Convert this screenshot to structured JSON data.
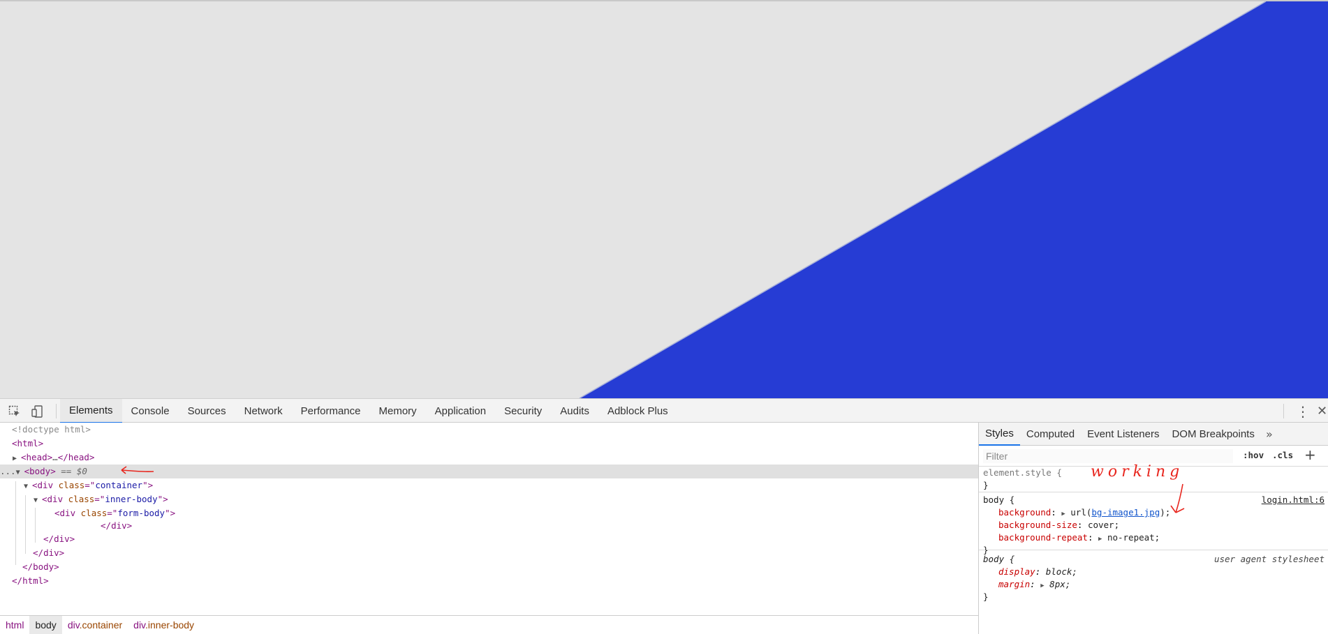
{
  "viewport": {
    "bg_color": "#e4e4e4",
    "shape_color": "#263cd4"
  },
  "toolbar": {
    "inspect_icon": "inspect-element-icon",
    "device_icon": "device-toolbar-icon",
    "tabs": [
      {
        "label": "Elements",
        "active": true
      },
      {
        "label": "Console"
      },
      {
        "label": "Sources"
      },
      {
        "label": "Network"
      },
      {
        "label": "Performance"
      },
      {
        "label": "Memory"
      },
      {
        "label": "Application"
      },
      {
        "label": "Security"
      },
      {
        "label": "Audits"
      },
      {
        "label": "Adblock Plus"
      }
    ],
    "menu_icon": "kebab-menu-icon",
    "close_icon": "close-icon"
  },
  "dom": {
    "doctype": "<!doctype html>",
    "html_open": "html",
    "head": "head",
    "head_ellipsis": "…",
    "body_tag": "body",
    "body_suffix": "== $0",
    "ellipsis": "...",
    "div_tag": "div",
    "class_attr": "class",
    "container_class": "container",
    "inner_body_class": "inner-body",
    "form_body_class": "form-body"
  },
  "breadcrumb": {
    "items": [
      "html",
      "body",
      "div",
      "div"
    ],
    "classes": [
      "",
      "",
      ".container",
      ".inner-body"
    ]
  },
  "sidebar": {
    "tabs": [
      "Styles",
      "Computed",
      "Event Listeners",
      "DOM Breakpoints"
    ],
    "more_icon": "chevron-double-right-icon",
    "filter_placeholder": "Filter",
    "hov_label": ":hov",
    "cls_label": ".cls",
    "plus_label": "+",
    "element_style_selector": "element.style {",
    "close_brace": "}",
    "body_selector": "body {",
    "body_source": "login.html:6",
    "bg_prop": "background",
    "bg_val_prefix": "url(",
    "bg_link": "bg-image1.jpg",
    "bg_val_suffix": ");",
    "bgsize_prop": "background-size",
    "bgsize_val": "cover;",
    "bgrepeat_prop": "background-repeat",
    "bgrepeat_val": "no-repeat;",
    "ua_selector": "body {",
    "ua_source": "user agent stylesheet",
    "display_prop": "display",
    "display_val": "block;",
    "margin_prop": "margin",
    "margin_val": "8px;"
  },
  "annotation": {
    "text": "working",
    "color": "#e8261e"
  }
}
